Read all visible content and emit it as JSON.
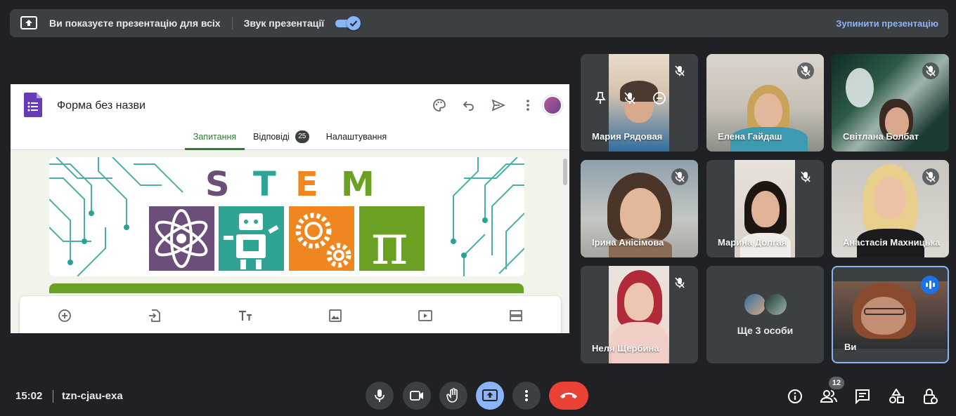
{
  "banner": {
    "presenting_text": "Ви показуєте презентацію для всіх",
    "audio_label": "Звук презентації",
    "audio_enabled": true,
    "stop_label": "Зупинити презентацію"
  },
  "form": {
    "title": "Форма без назви",
    "tabs": [
      {
        "label": "Запитання",
        "active": true
      },
      {
        "label": "Відповіді",
        "badge": "25"
      },
      {
        "label": "Налаштування"
      }
    ],
    "header_icons": [
      "palette-icon",
      "undo-icon",
      "send-icon",
      "more-vert-icon",
      "account-avatar"
    ],
    "banner_word": [
      "S",
      "T",
      "E",
      "M"
    ],
    "banner_letter_colors": [
      "#6b4f7a",
      "#2fa394",
      "#f0861f",
      "#6aa122"
    ],
    "toolbar_icons": [
      "add-question-icon",
      "import-questions-icon",
      "add-title-icon",
      "add-image-icon",
      "add-video-icon",
      "add-section-icon"
    ],
    "brand_color": "#673ab7"
  },
  "participants": [
    {
      "name": "Мария Рядовая",
      "muted": true,
      "hovered": true
    },
    {
      "name": "Елена Гайдаш",
      "muted": true
    },
    {
      "name": "Світлана Болбат",
      "muted": true
    },
    {
      "name": "Ірина Анісімова",
      "muted": true
    },
    {
      "name": "Марина Долгая",
      "muted": true
    },
    {
      "name": "Анастасія Махницька",
      "muted": true
    },
    {
      "name": "Неля Щербина",
      "muted": true
    },
    {
      "more": "Ще 3 особи"
    },
    {
      "name": "Ви",
      "speaking": true
    }
  ],
  "bottom": {
    "time": "15:02",
    "meeting_code": "tzn-cjau-exa",
    "participant_count": "12"
  }
}
